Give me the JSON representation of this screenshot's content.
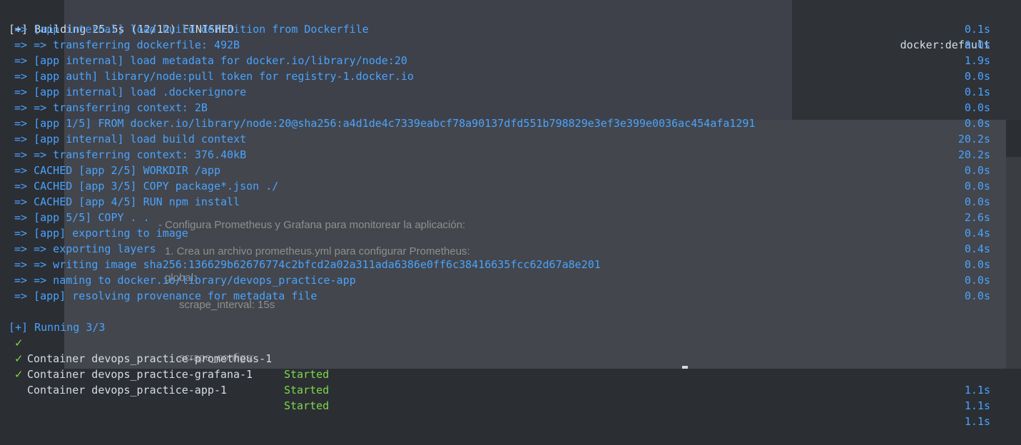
{
  "header": {
    "title": "[+] Building 25.5s (12/12) FINISHED",
    "context": "docker:default"
  },
  "build_steps": [
    {
      "text": "=> [app internal] load build definition from Dockerfile",
      "time": "0.1s"
    },
    {
      "text": "=> => transferring dockerfile: 492B",
      "time": "0.0s"
    },
    {
      "text": "=> [app internal] load metadata for docker.io/library/node:20",
      "time": "1.9s"
    },
    {
      "text": "=> [app auth] library/node:pull token for registry-1.docker.io",
      "time": "0.0s"
    },
    {
      "text": "=> [app internal] load .dockerignore",
      "time": "0.1s"
    },
    {
      "text": "=> => transferring context: 2B",
      "time": "0.0s"
    },
    {
      "text": "=> [app 1/5] FROM docker.io/library/node:20@sha256:a4d1de4c7339eabcf78a90137dfd551b798829e3ef3e399e0036ac454afa1291",
      "time": "0.0s"
    },
    {
      "text": "=> [app internal] load build context",
      "time": "20.2s"
    },
    {
      "text": "=> => transferring context: 376.40kB",
      "time": "20.2s"
    },
    {
      "text": "=> CACHED [app 2/5] WORKDIR /app",
      "time": "0.0s"
    },
    {
      "text": "=> CACHED [app 3/5] COPY package*.json ./",
      "time": "0.0s"
    },
    {
      "text": "=> CACHED [app 4/5] RUN npm install",
      "time": "0.0s"
    },
    {
      "text": "=> [app 5/5] COPY . .",
      "time": "2.6s"
    },
    {
      "text": "=> [app] exporting to image",
      "time": "0.4s"
    },
    {
      "text": "=> => exporting layers",
      "time": "0.4s"
    },
    {
      "text": "=> => writing image sha256:136629b62676774c2bfcd2a02a311ada6386e0ff6c38416635fcc62d67a8e201",
      "time": "0.0s"
    },
    {
      "text": "=> => naming to docker.io/library/devops_practice-app",
      "time": "0.0s"
    },
    {
      "text": "=> [app] resolving provenance for metadata file",
      "time": "0.0s"
    }
  ],
  "running": {
    "title": "[+] Running 3/3"
  },
  "containers": [
    {
      "check": "✓",
      "name": "Container devops_practice-prometheus-1",
      "status": "Started",
      "time": "1.1s"
    },
    {
      "check": "✓",
      "name": "Container devops_practice-grafana-1",
      "status": "Started",
      "time": "1.1s"
    },
    {
      "check": "✓",
      "name": "Container devops_practice-app-1",
      "status": "Started",
      "time": "1.1s"
    }
  ],
  "background_doc": {
    "line1": "- Configura Prometheus y Grafana para monitorear la aplicación:",
    "line2": "1. Crea un archivo prometheus.yml para configurar Prometheus:",
    "line3": "global:",
    "line4": "scrape_interval: 15s",
    "line5": "scrape_configs:"
  }
}
